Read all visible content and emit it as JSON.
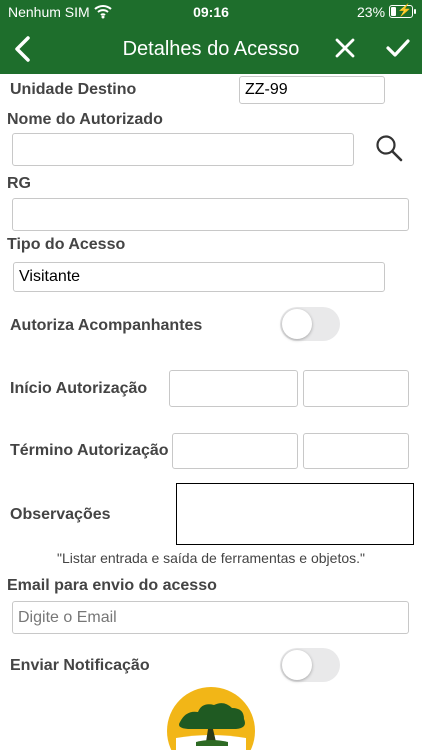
{
  "status": {
    "carrier": "Nenhum SIM",
    "time": "09:16",
    "battery": "23%"
  },
  "header": {
    "title": "Detalhes do Acesso",
    "icons": [
      "back-icon",
      "close-icon",
      "check-icon"
    ]
  },
  "form": {
    "unidade_label": "Unidade Destino",
    "unidade_value": "ZZ-99",
    "nome_label": "Nome do Autorizado",
    "nome_value": "",
    "rg_label": "RG",
    "rg_value": "",
    "tipo_label": "Tipo do Acesso",
    "tipo_value": "Visitante",
    "acompanhantes_label": "Autoriza Acompanhantes",
    "inicio_label": "Início Autorização",
    "termino_label": "Término Autorização",
    "observacoes_label": "Observações",
    "observacoes_hint": "\"Listar entrada e saída de ferramentas e objetos.\"",
    "email_label": "Email para envio do acesso",
    "email_placeholder": "Digite o Email",
    "notificacao_label": "Enviar Notificação"
  },
  "colors": {
    "brand_green": "#1e6e2c",
    "toggle_off": "#e9e9ea"
  }
}
